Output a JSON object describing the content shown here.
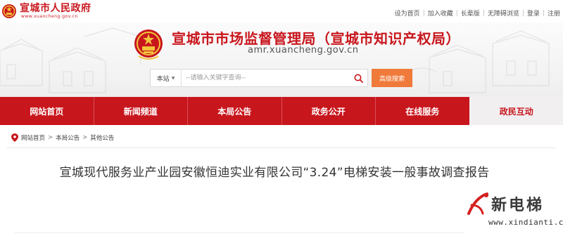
{
  "portal": {
    "name": "宣城市人民政府",
    "url": "www.xuancheng.gov.cn"
  },
  "util_links": [
    "设为首页",
    "加入收藏",
    "长辈版",
    "无障碍浏览",
    "登录",
    "注册"
  ],
  "banner": {
    "title": "宣城市市场监督管理局（宣城市知识产权局）",
    "domain": "amr.xuancheng.gov.cn"
  },
  "search": {
    "scope": "本站",
    "placeholder": "--请输入关键字查询--",
    "advanced_label": "高级搜索"
  },
  "nav": {
    "items": [
      "网站首页",
      "新闻频道",
      "本局公告",
      "政务公开",
      "在线服务",
      "政民互动"
    ],
    "active_index": 5
  },
  "breadcrumb": [
    "网站首页",
    "本局公告",
    "其他公告"
  ],
  "article": {
    "title": "宣城现代服务业产业园安徽恒迪实业有限公司“3.24”电梯安装一般事故调查报告"
  },
  "watermark": {
    "name": "新电梯",
    "url": "www.xindianti.cn"
  },
  "colors": {
    "brand_red": "#c8161d",
    "accent_orange": "#f07a3a"
  }
}
